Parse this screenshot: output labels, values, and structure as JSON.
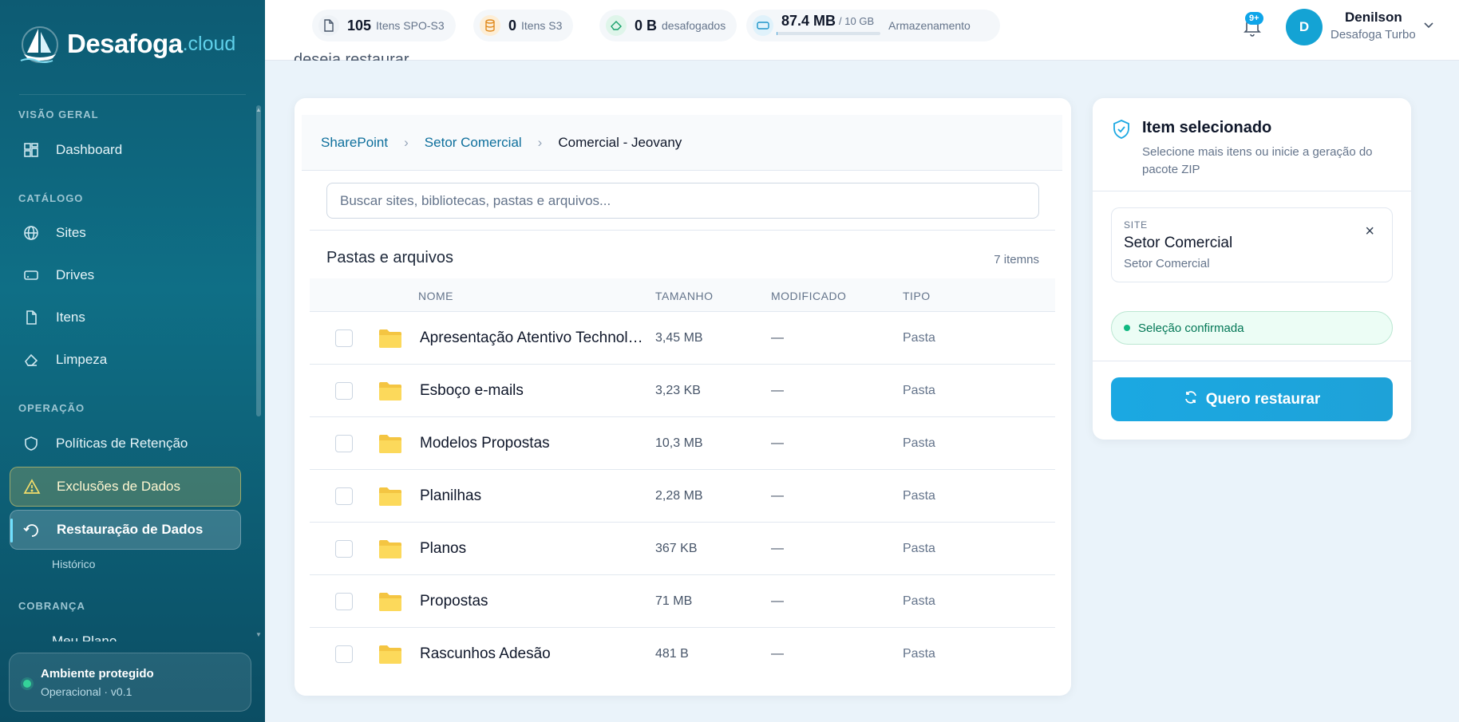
{
  "brand": {
    "name": "Desafoga",
    "suffix": ".cloud"
  },
  "sidebar": {
    "sections": {
      "overview": "VISÃO GERAL",
      "catalog": "CATÁLOGO",
      "operation": "OPERAÇÃO",
      "billing": "COBRANÇA"
    },
    "items": {
      "dashboard": "Dashboard",
      "sites": "Sites",
      "drives": "Drives",
      "itens": "Itens",
      "limpeza": "Limpeza",
      "politicas": "Políticas de Retenção",
      "exclusoes": "Exclusões de Dados",
      "restauracao": "Restauração de Dados",
      "historico": "Histórico",
      "cut_item": "Meu Plano"
    },
    "env": {
      "title": "Ambiente protegido",
      "subtitle": "Operacional · v0.1"
    }
  },
  "topbar": {
    "stats": [
      {
        "num": "105",
        "label": "Itens SPO-S3"
      },
      {
        "num": "0",
        "label": "Itens S3"
      },
      {
        "num": "0 B",
        "label": "desafogados"
      }
    ],
    "storage": {
      "used": "87.4 MB",
      "total": "/ 10 GB",
      "label": "Armazenamento",
      "fraction": 0.0087
    },
    "notifications": "9+",
    "user": {
      "initial": "D",
      "name": "Denilson",
      "plan": "Desafoga Turbo"
    }
  },
  "page": {
    "bg_text": "deseja restaurar."
  },
  "breadcrumb": {
    "root": "SharePoint",
    "site": "Setor Comercial",
    "current": "Comercial - Jeovany"
  },
  "search": {
    "placeholder": "Buscar sites, bibliotecas, pastas e arquivos..."
  },
  "listing": {
    "title": "Pastas e arquivos",
    "count": "7 itemns",
    "columns": {
      "name": "NOME",
      "size": "TAMANHO",
      "modified": "MODIFICADO",
      "type": "TIPO"
    },
    "rows": [
      {
        "name": "Apresentação Atentivo Technology",
        "size": "3,45 MB",
        "modified": "—",
        "type": "Pasta"
      },
      {
        "name": "Esboço e-mails",
        "size": "3,23 KB",
        "modified": "—",
        "type": "Pasta"
      },
      {
        "name": "Modelos Propostas",
        "size": "10,3 MB",
        "modified": "—",
        "type": "Pasta"
      },
      {
        "name": "Planilhas",
        "size": "2,28 MB",
        "modified": "—",
        "type": "Pasta"
      },
      {
        "name": "Planos",
        "size": "367 KB",
        "modified": "—",
        "type": "Pasta"
      },
      {
        "name": "Propostas",
        "size": "71 MB",
        "modified": "—",
        "type": "Pasta"
      },
      {
        "name": "Rascunhos Adesão",
        "size": "481 B",
        "modified": "—",
        "type": "Pasta"
      }
    ]
  },
  "selection": {
    "title": "Item selecionado",
    "description": "Selecione mais itens ou inicie a geração do pacote ZIP",
    "site_label": "SITE",
    "site_name": "Setor Comercial",
    "site_sub": "Setor Comercial",
    "confirmed": "Seleção confirmada",
    "button": "Quero restaurar"
  },
  "colors": {
    "accent": "#1ba8e2",
    "sidebar": "#0d5b73",
    "success": "#10b981",
    "warning": "#e6d26e"
  }
}
